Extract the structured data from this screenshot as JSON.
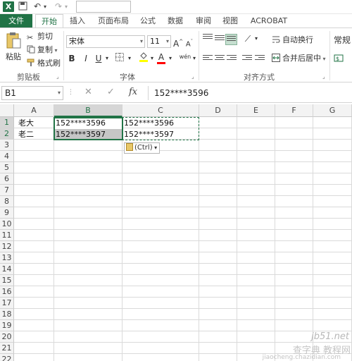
{
  "tabs": [
    "文件",
    "开始",
    "插入",
    "页面布局",
    "公式",
    "数据",
    "审阅",
    "视图",
    "ACROBAT"
  ],
  "clipboard": {
    "paste": "粘贴",
    "cut": "剪切",
    "copy": "复制",
    "format_painter": "格式刷",
    "group": "剪贴板"
  },
  "font": {
    "name": "宋体",
    "size": "11",
    "grow": "A",
    "shrink": "A",
    "bold": "B",
    "italic": "I",
    "underline": "U",
    "color_letter": "A",
    "phonetic": "wén",
    "group": "字体"
  },
  "alignment": {
    "wrap": "自动换行",
    "merge": "合并后居中",
    "group": "对齐方式"
  },
  "number": {
    "format": "常规"
  },
  "formula_bar": {
    "name_box": "B1",
    "fx": "fx",
    "content": "152****3596"
  },
  "columns": [
    "A",
    "B",
    "C",
    "D",
    "E",
    "F",
    "G"
  ],
  "rows": [
    "1",
    "2",
    "3",
    "4",
    "5",
    "6",
    "7",
    "8",
    "9",
    "10",
    "11",
    "12",
    "13",
    "14",
    "15",
    "16",
    "17",
    "18",
    "19",
    "20",
    "21",
    "22"
  ],
  "cells": {
    "A1": "老大",
    "A2": "老二",
    "B1": "152****3596",
    "B2": "152****3597",
    "C1": "152****3596",
    "C2": "152****3597"
  },
  "paste_options": {
    "label": "(Ctrl)"
  },
  "watermark": {
    "line1": "jb51.net",
    "line2": "查字典 教程网",
    "line3": "jiaocheng.chazidian.com"
  },
  "colors": {
    "accent": "#217346",
    "selection": "#c6c6c6"
  }
}
